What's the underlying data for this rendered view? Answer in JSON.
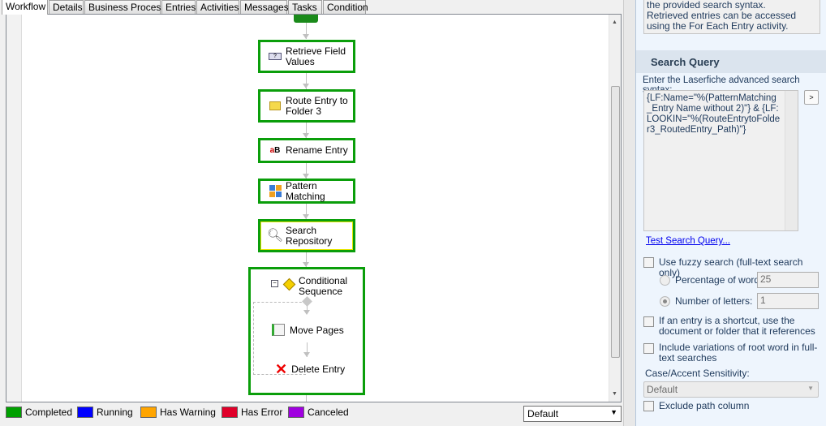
{
  "tabs": [
    "Workflow",
    "Details",
    "Business Process",
    "Entries",
    "Activities",
    "Messages",
    "Tasks",
    "Condition"
  ],
  "activities": [
    {
      "label": "Retrieve Field Values",
      "icon": "retrieve-field-values-icon"
    },
    {
      "label": "Route Entry to Folder 3",
      "icon": "folder-icon"
    },
    {
      "label": "Rename Entry",
      "icon": "rename-icon"
    },
    {
      "label": "Pattern Matching",
      "icon": "pattern-matching-icon"
    },
    {
      "label": "Search Repository",
      "icon": "magnifier-icon"
    }
  ],
  "conditional": {
    "label": "Conditional Sequence",
    "children": [
      "Move Pages",
      "Delete Entry"
    ]
  },
  "legend": [
    {
      "label": "Completed",
      "color": "#00a000"
    },
    {
      "label": "Running",
      "color": "#0000ff"
    },
    {
      "label": "Has Warning",
      "color": "#ffa500"
    },
    {
      "label": "Has Error",
      "color": "#e0002a"
    },
    {
      "label": "Canceled",
      "color": "#a000e0"
    }
  ],
  "view_select": "Default",
  "right": {
    "description": "the provided search syntax.  Retrieved entries can be accessed using the For Each Entry activity.",
    "section_title": "Search Query",
    "query_label": "Enter the Laserfiche advanced search syntax:",
    "query": "{LF:Name=\"%(PatternMatching_Entry Name without 2)\"} & {LF:LOOKIN=\"%(RouteEntrytoFolder3_RoutedEntry_Path)\"}",
    "insert_button": ">",
    "test_link": "Test Search Query...",
    "fuzzy_label": "Use fuzzy search (full-text search only)",
    "percent_label": "Percentage of word:",
    "percent_value": "25",
    "letters_label": "Number of letters:",
    "letters_value": "1",
    "shortcut_label": "If an entry is a shortcut, use the document or folder that it references",
    "variations_label": "Include variations of root word in full-text searches",
    "case_label": "Case/Accent Sensitivity:",
    "case_value": "Default",
    "exclude_label": "Exclude path column"
  }
}
